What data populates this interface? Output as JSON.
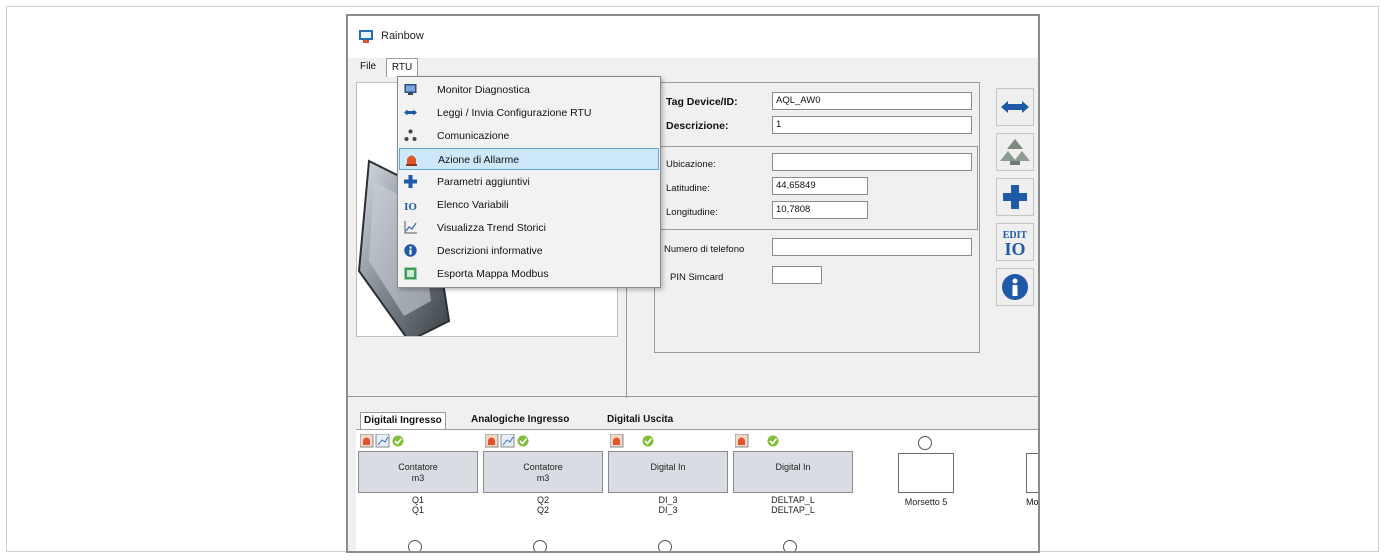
{
  "window": {
    "title": "Rainbow"
  },
  "menubar": {
    "file": "File",
    "rtu": "RTU"
  },
  "rtu_menu": {
    "items": [
      {
        "label": "Monitor Diagnostica",
        "icon": "monitor-icon"
      },
      {
        "label": "Leggi / Invia Configurazione RTU",
        "icon": "transfer-arrows-icon"
      },
      {
        "label": "Comunicazione",
        "icon": "network-icon"
      },
      {
        "label": "Azione di Allarme",
        "icon": "alarm-icon",
        "highlighted": true
      },
      {
        "label": "Parametri aggiuntivi",
        "icon": "plus-icon"
      },
      {
        "label": "Elenco Variabili",
        "icon": "io-list-icon"
      },
      {
        "label": "Visualizza Trend Storici",
        "icon": "trend-chart-icon"
      },
      {
        "label": "Descrizioni informative",
        "icon": "info-icon"
      },
      {
        "label": "Esporta Mappa Modbus",
        "icon": "export-icon"
      }
    ]
  },
  "form": {
    "tag_label": "Tag Device/ID:",
    "tag_value": "AQL_AW0",
    "desc_label": "Descrizione:",
    "desc_value": "1",
    "ubicazione_label": "Ubicazione:",
    "ubicazione_value": "",
    "latitudine_label": "Latitudine:",
    "latitudine_value": "44,65849",
    "longitudine_label": "Longitudine:",
    "longitudine_value": "10,7808",
    "telefono_label": "Numero di telefono",
    "telefono_value": "",
    "pin_label": "PIN Simcard",
    "pin_value": ""
  },
  "toolbar_right": [
    "transfer-arrows-icon",
    "network-icon",
    "plus-icon",
    "edit-io-icon",
    "info-icon"
  ],
  "tabs": [
    "Digitali Ingresso",
    "Analogiche Ingresso",
    "Digitali Uscita"
  ],
  "io_channels": [
    {
      "button_line1": "Contatore",
      "button_line2": "m3",
      "tag1": "Q1",
      "tag2": "Q1",
      "icons": [
        "alarm",
        "trend",
        "ok"
      ]
    },
    {
      "button_line1": "Contatore",
      "button_line2": "m3",
      "tag1": "Q2",
      "tag2": "Q2",
      "icons": [
        "alarm",
        "trend",
        "ok"
      ]
    },
    {
      "button_line1": "Digital In",
      "button_line2": "",
      "tag1": "DI_3",
      "tag2": "DI_3",
      "icons": [
        "alarm",
        "ok"
      ]
    },
    {
      "button_line1": "Digital In",
      "button_line2": "",
      "tag1": "DELTAP_L",
      "tag2": "DELTAP_L",
      "icons": [
        "alarm",
        "ok"
      ]
    }
  ],
  "empty_slots": [
    {
      "label": "Morsetto 5"
    },
    {
      "label": "Mor"
    }
  ],
  "colors": {
    "highlight": "#cce8fa",
    "highlight_border": "#5fa6d8",
    "icon_blue": "#1f5aa8"
  }
}
